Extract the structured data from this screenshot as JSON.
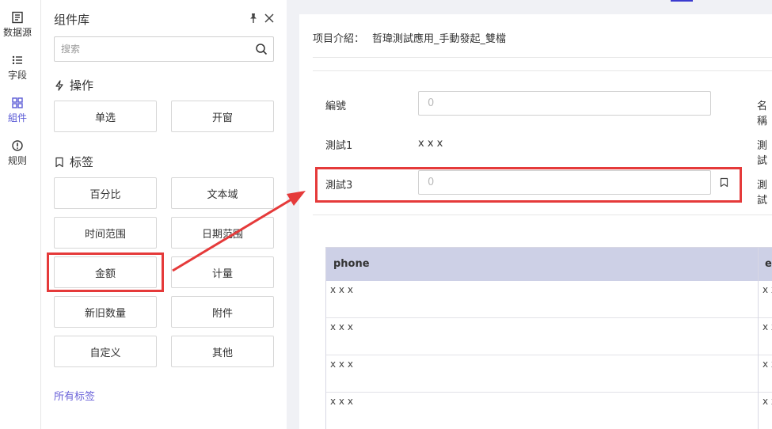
{
  "rail": {
    "items": [
      {
        "label": "数据源",
        "icon": "datasource-icon"
      },
      {
        "label": "字段",
        "icon": "list-icon"
      },
      {
        "label": "組件",
        "icon": "grid-icon",
        "active": true
      },
      {
        "label": "规则",
        "icon": "alert-circle-icon"
      }
    ]
  },
  "panel": {
    "title": "组件库",
    "search_placeholder": "搜索",
    "sections": {
      "actions": {
        "title": "操作",
        "buttons": [
          "单选",
          "开窗"
        ]
      },
      "tags": {
        "title": "标签",
        "buttons": [
          "百分比",
          "文本域",
          "时间范围",
          "日期范围",
          "金额",
          "计量",
          "新旧数量",
          "附件",
          "自定义",
          "其他"
        ]
      }
    },
    "all_tags_link": "所有标签"
  },
  "form": {
    "intro_label": "项目介紹：",
    "intro_value": "哲瑋測試應用_手動發起_雙檔",
    "fields": {
      "bianhao_label": "編號",
      "bianhao_value": "0",
      "right1_label": "名稱",
      "test1_label": "測試1",
      "test1_value": "x x x",
      "right2_label": "測試",
      "test3_label": "測試3",
      "test3_value": "0",
      "right3_label": "測試"
    }
  },
  "table": {
    "headers": [
      "phone",
      "em"
    ],
    "rows": [
      [
        "x x x",
        "x x"
      ],
      [
        "x x x",
        "x x"
      ],
      [
        "x x x",
        "x x"
      ],
      [
        "x x x",
        "x x"
      ]
    ]
  },
  "colors": {
    "accent": "#5b5bd6",
    "highlight": "#e53a3a",
    "table_header": "#cdd0e6"
  }
}
